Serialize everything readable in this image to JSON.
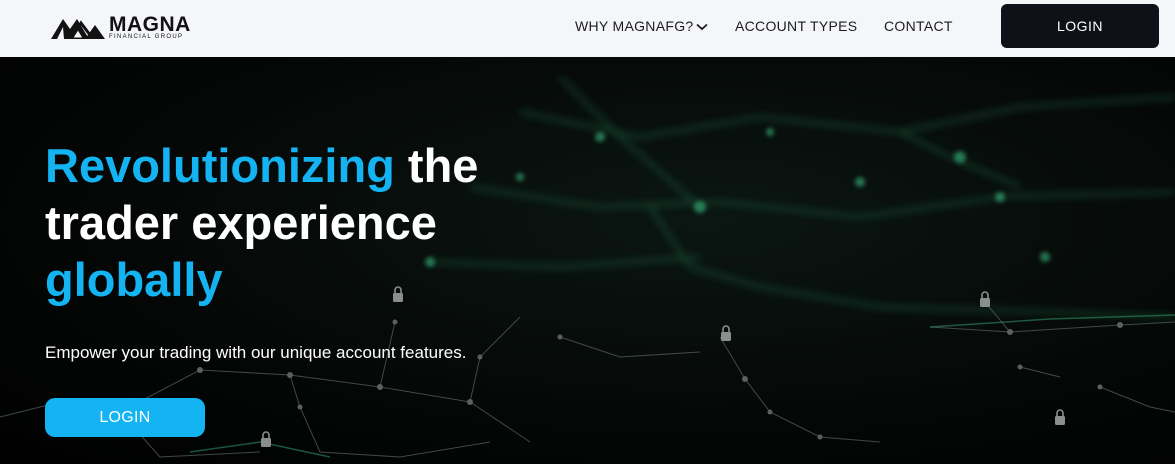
{
  "header": {
    "brand": "MAGNA",
    "brand_sub": "FINANCIAL GROUP",
    "nav": [
      {
        "label": "WHY MAGNAFG?"
      },
      {
        "label": "ACCOUNT TYPES"
      },
      {
        "label": "CONTACT"
      }
    ],
    "login_label": "LOGIN"
  },
  "hero": {
    "headline_part1": "Revolutionizing",
    "headline_part2": " the trader experience ",
    "headline_part3": "globally",
    "tagline": "Empower your trading with our unique account features.",
    "login_label": "LOGIN"
  },
  "colors": {
    "accent": "#14b3f2",
    "header_bg": "#f5f6fa",
    "dark_button": "#0e1118",
    "network_green": "#3ec98a"
  },
  "icons": [
    "magna-logo-icon",
    "chevron-down-icon",
    "lock-icon"
  ]
}
